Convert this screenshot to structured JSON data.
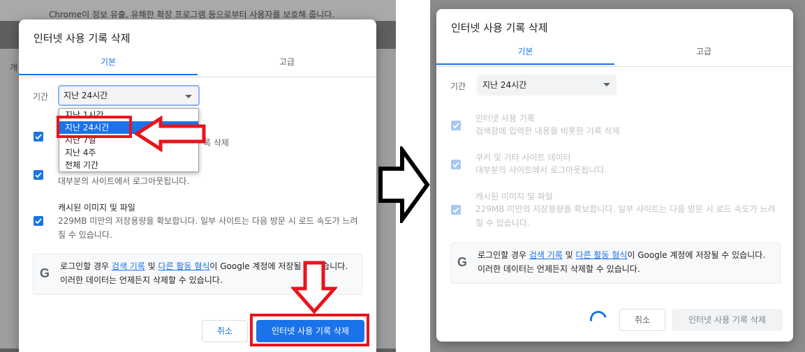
{
  "background": {
    "banner_text": "Chrome이 정보 유출, 유해한 확장 프로그램 등으로부터 사용자를 보호해 줍니다.",
    "side_glyph": "개"
  },
  "dialog": {
    "title": "인터넷 사용 기록 삭제",
    "tabs": [
      "기본",
      "고급"
    ],
    "time_range_label": "기간",
    "time_range_value": "지난 24시간",
    "dropdown_options": [
      "지난 1시간",
      "지난 24시간",
      "지난 7일",
      "지난 4주",
      "전체 기간"
    ],
    "options": [
      {
        "title": "인터넷 사용 기록",
        "desc": "검색창에 입력한 내용을 비롯한 기록 삭제"
      },
      {
        "title": "쿠키 및 기타 사이트 데이터",
        "desc": "대부분의 사이트에서 로그아웃됩니다."
      },
      {
        "title": "캐시된 이미지 및 파일",
        "desc": "229MB 미만의 저장용량을 확보합니다. 일부 사이트는 다음 방문 시 로드 속도가 느려질 수 있습니다."
      }
    ],
    "left_partial": {
      "desc0_tail": "록 삭제"
    },
    "info": {
      "prefix": "로그인할 경우 ",
      "link1": "검색 기록",
      "mid": " 및 ",
      "link2": "다른 활동 형식",
      "suffix": "이 Google 계정에 저장될 수 있습니다. 이러한 데이터는 언제든지 삭제할 수 있습니다."
    },
    "cancel_label": "취소",
    "confirm_label": "인터넷 사용 기록 삭제"
  },
  "colors": {
    "accent": "#1a73e8",
    "annotation_red": "#e8141b"
  }
}
